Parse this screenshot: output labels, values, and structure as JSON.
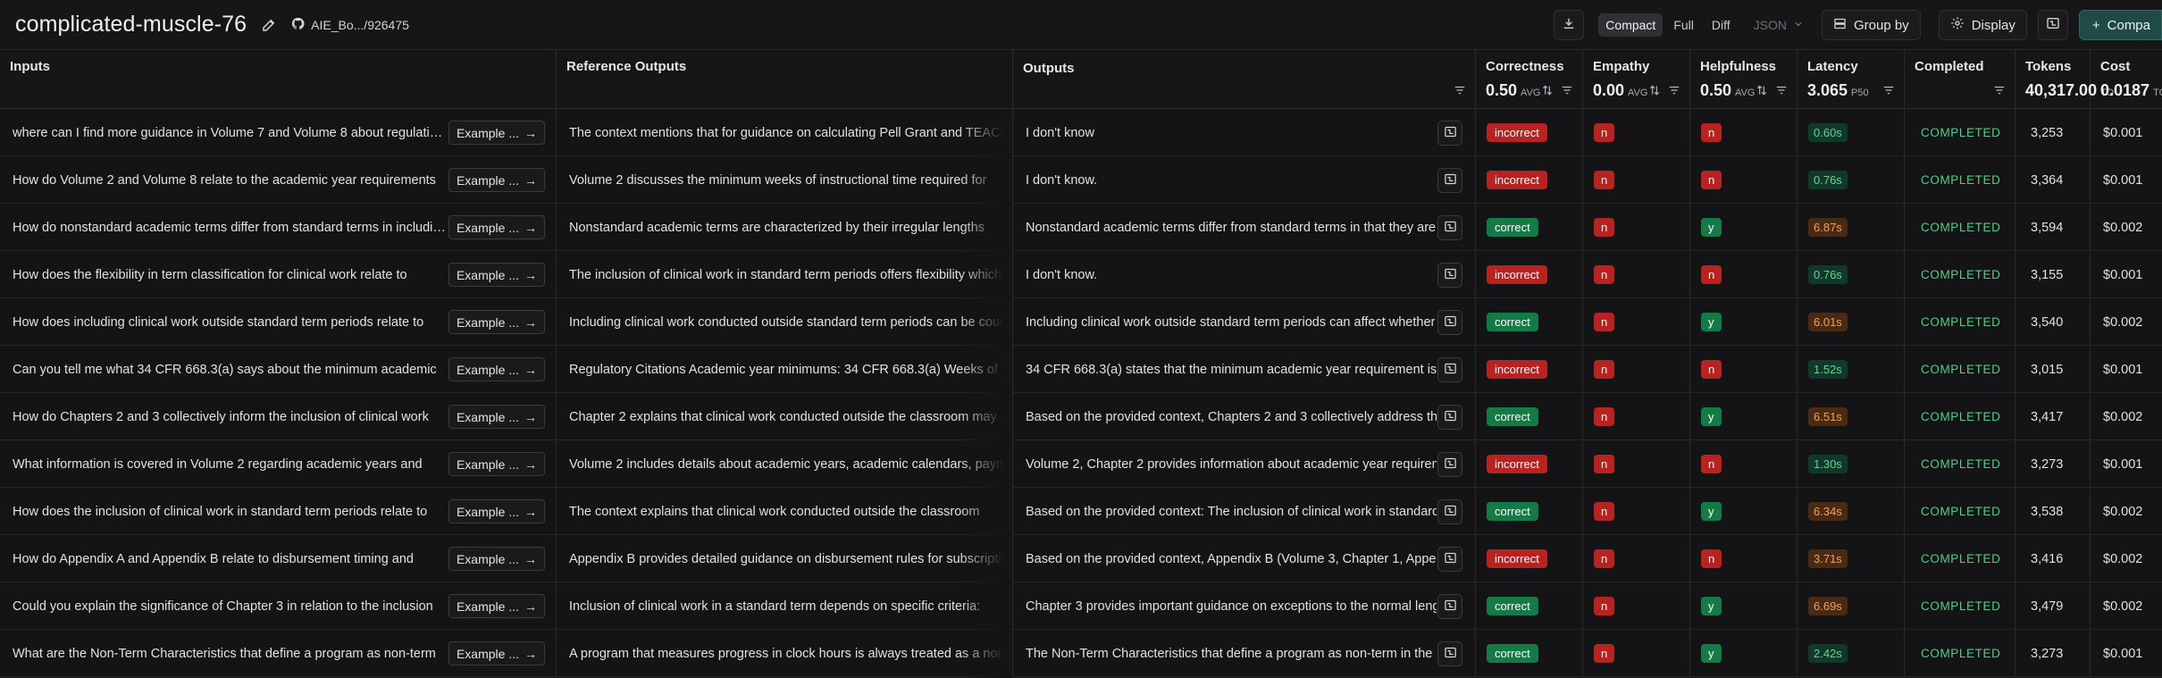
{
  "header": {
    "title": "complicated-muscle-76",
    "repo": "AIE_Bo.../926475",
    "view_modes": [
      "Compact",
      "Full",
      "Diff"
    ],
    "active_view": "Compact",
    "format": "JSON",
    "group_by": "Group by",
    "display": "Display",
    "compare": "Compa"
  },
  "columns": {
    "inputs": "Inputs",
    "reference": "Reference Outputs",
    "outputs": "Outputs",
    "correctness": {
      "label": "Correctness",
      "value": "0.50",
      "unit": "AVG"
    },
    "empathy": {
      "label": "Empathy",
      "value": "0.00",
      "unit": "AVG"
    },
    "helpfulness": {
      "label": "Helpfulness",
      "value": "0.50",
      "unit": "AVG"
    },
    "latency": {
      "label": "Latency",
      "value": "3.065",
      "unit": "P50"
    },
    "completed": {
      "label": "Completed"
    },
    "tokens": {
      "label": "Tokens",
      "value": "40,317.00",
      "unit": "TO"
    },
    "cost": {
      "label": "Cost",
      "value": "0.0187",
      "unit": "TO"
    }
  },
  "example_label": "Example ...",
  "rows": [
    {
      "input": "where can I find more guidance in Volume 7 and Volume 8 about regulations",
      "reference": "The context mentions that for guidance on calculating Pell Grant and TEACH",
      "output": "I don't know",
      "correctness": "incorrect",
      "empathy": "n",
      "helpfulness": "n",
      "latency": "0.60s",
      "lat_level": "g",
      "status": "COMPLETED",
      "tokens": "3,253",
      "cost": "$0.001"
    },
    {
      "input": "How do Volume 2 and Volume 8 relate to the academic year requirements",
      "reference": "Volume 2 discusses the minimum weeks of instructional time required for",
      "output": "I don't know.",
      "correctness": "incorrect",
      "empathy": "n",
      "helpfulness": "n",
      "latency": "0.76s",
      "lat_level": "g",
      "status": "COMPLETED",
      "tokens": "3,364",
      "cost": "$0.001"
    },
    {
      "input": "How do nonstandard academic terms differ from standard terms in including",
      "reference": "Nonstandard academic terms are characterized by their irregular lengths",
      "output": "Nonstandard academic terms differ from standard terms in that they are",
      "correctness": "correct",
      "empathy": "n",
      "helpfulness": "y",
      "latency": "6.87s",
      "lat_level": "o",
      "status": "COMPLETED",
      "tokens": "3,594",
      "cost": "$0.002"
    },
    {
      "input": "How does the flexibility in term classification for clinical work relate to",
      "reference": "The inclusion of clinical work in standard term periods offers flexibility which",
      "output": "I don't know.",
      "correctness": "incorrect",
      "empathy": "n",
      "helpfulness": "n",
      "latency": "0.76s",
      "lat_level": "g",
      "status": "COMPLETED",
      "tokens": "3,155",
      "cost": "$0.001"
    },
    {
      "input": "How does including clinical work outside standard term periods relate to",
      "reference": "Including clinical work conducted outside standard term periods can be counted",
      "output": "Including clinical work outside standard term periods can affect whether",
      "correctness": "correct",
      "empathy": "n",
      "helpfulness": "y",
      "latency": "6.01s",
      "lat_level": "o",
      "status": "COMPLETED",
      "tokens": "3,540",
      "cost": "$0.002"
    },
    {
      "input": "Can you tell me what 34 CFR 668.3(a) says about the minimum academic",
      "reference": "Regulatory Citations Academic year minimums: 34 CFR 668.3(a) Weeks of",
      "output": "34 CFR 668.3(a) states that the minimum academic year requirement is",
      "correctness": "incorrect",
      "empathy": "n",
      "helpfulness": "n",
      "latency": "1.52s",
      "lat_level": "g",
      "status": "COMPLETED",
      "tokens": "3,015",
      "cost": "$0.001"
    },
    {
      "input": "How do Chapters 2 and 3 collectively inform the inclusion of clinical work",
      "reference": "Chapter 2 explains that clinical work conducted outside the classroom may",
      "output": "Based on the provided context, Chapters 2 and 3 collectively address the",
      "correctness": "correct",
      "empathy": "n",
      "helpfulness": "y",
      "latency": "6.51s",
      "lat_level": "o",
      "status": "COMPLETED",
      "tokens": "3,417",
      "cost": "$0.002"
    },
    {
      "input": "What information is covered in Volume 2 regarding academic years and",
      "reference": "Volume 2 includes details about academic years, academic calendars, payment",
      "output": "Volume 2, Chapter 2 provides information about academic year requirements",
      "correctness": "incorrect",
      "empathy": "n",
      "helpfulness": "n",
      "latency": "1.30s",
      "lat_level": "g",
      "status": "COMPLETED",
      "tokens": "3,273",
      "cost": "$0.001"
    },
    {
      "input": "How does the inclusion of clinical work in standard term periods relate to",
      "reference": "The context explains that clinical work conducted outside the classroom",
      "output": "Based on the provided context: The inclusion of clinical work in standard",
      "correctness": "correct",
      "empathy": "n",
      "helpfulness": "y",
      "latency": "6.34s",
      "lat_level": "o",
      "status": "COMPLETED",
      "tokens": "3,538",
      "cost": "$0.002"
    },
    {
      "input": "How do Appendix A and Appendix B relate to disbursement timing and",
      "reference": "Appendix B provides detailed guidance on disbursement rules for subscription",
      "output": "Based on the provided context, Appendix B (Volume 3, Chapter 1, Appendix",
      "correctness": "incorrect",
      "empathy": "n",
      "helpfulness": "n",
      "latency": "3.71s",
      "lat_level": "o",
      "status": "COMPLETED",
      "tokens": "3,416",
      "cost": "$0.002"
    },
    {
      "input": "Could you explain the significance of Chapter 3 in relation to the inclusion",
      "reference": "Inclusion of clinical work in a standard term depends on specific criteria:",
      "output": "Chapter 3 provides important guidance on exceptions to the normal length",
      "correctness": "correct",
      "empathy": "n",
      "helpfulness": "y",
      "latency": "6.69s",
      "lat_level": "o",
      "status": "COMPLETED",
      "tokens": "3,479",
      "cost": "$0.002"
    },
    {
      "input": "What are the Non-Term Characteristics that define a program as non-term",
      "reference": "A program that measures progress in clock hours is always treated as a non-term",
      "output": "The Non-Term Characteristics that define a program as non-term in the",
      "correctness": "correct",
      "empathy": "n",
      "helpfulness": "y",
      "latency": "2.42s",
      "lat_level": "g",
      "status": "COMPLETED",
      "tokens": "3,273",
      "cost": "$0.001"
    }
  ]
}
